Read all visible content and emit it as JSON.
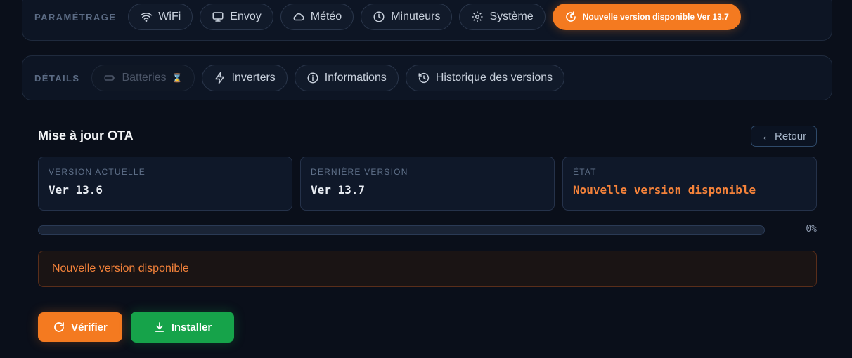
{
  "settings": {
    "label": "PARAMÉTRAGE",
    "tabs": [
      {
        "label": "WiFi",
        "icon": "wifi-icon"
      },
      {
        "label": "Envoy",
        "icon": "monitor-icon"
      },
      {
        "label": "Météo",
        "icon": "cloud-icon"
      },
      {
        "label": "Minuteurs",
        "icon": "clock-icon"
      },
      {
        "label": "Système",
        "icon": "gear-icon"
      }
    ],
    "update_badge": "Nouvelle version disponible Ver 13.7"
  },
  "details": {
    "label": "DÉTAILS",
    "tabs": [
      {
        "label": "Batteries",
        "icon": "battery-icon",
        "disabled": true
      },
      {
        "label": "Inverters",
        "icon": "lightning-icon"
      },
      {
        "label": "Informations",
        "icon": "info-icon"
      },
      {
        "label": "Historique des versions",
        "icon": "history-icon"
      }
    ]
  },
  "ota": {
    "title": "Mise à jour OTA",
    "back_label": "← Retour",
    "cards": [
      {
        "label": "VERSION ACTUELLE",
        "value": "Ver 13.6"
      },
      {
        "label": "DERNIÈRE VERSION",
        "value": "Ver 13.7"
      },
      {
        "label": "ÉTAT",
        "value": "Nouvelle version disponible"
      }
    ],
    "progress_percent": 0,
    "progress_label": "0%",
    "message": "Nouvelle version disponible",
    "verify_label": "Vérifier",
    "install_label": "Installer"
  },
  "colors": {
    "accent": "#f47a20",
    "success": "#16a34a",
    "background": "#0a0f1a"
  }
}
